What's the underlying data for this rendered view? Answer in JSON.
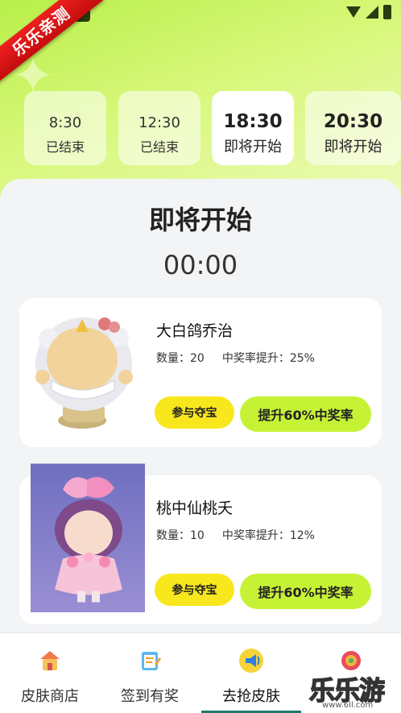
{
  "status_bar": {
    "icons": [
      "wifi-icon",
      "signal-icon",
      "battery-icon"
    ]
  },
  "ribbon": {
    "text": "乐乐亲测"
  },
  "time_slots": [
    {
      "time": "8:30",
      "status": "已结束"
    },
    {
      "time": "12:30",
      "status": "已结束"
    },
    {
      "time": "18:30",
      "status": "即将开始"
    },
    {
      "time": "20:30",
      "status": "即将开始"
    }
  ],
  "headline": "即将开始",
  "countdown": "00:00",
  "prizes": [
    {
      "name": "大白鸽乔治",
      "quantity": "数量：20",
      "win_rate": "中奖率提升：25%",
      "join_label": "参与夺宝",
      "boost_label": "提升60%中奖率"
    },
    {
      "name": "桃中仙桃夭",
      "quantity": "数量：10",
      "win_rate": "中奖率提升：12%",
      "join_label": "参与夺宝",
      "boost_label": "提升60%中奖率"
    }
  ],
  "nav": [
    {
      "label": "皮肤商店",
      "icon": "shop-icon"
    },
    {
      "label": "签到有奖",
      "icon": "checkin-icon"
    },
    {
      "label": "去抢皮肤",
      "icon": "megaphone-icon",
      "active": true
    },
    {
      "label": "",
      "icon": "profile-icon"
    }
  ],
  "watermark": {
    "title": "乐乐游戏",
    "url": "www.6ll.com"
  },
  "colors": {
    "accent_green": "#c6f235",
    "accent_yellow": "#f8e71c",
    "ribbon_red": "#e21414",
    "nav_active": "#1f7a6a"
  }
}
